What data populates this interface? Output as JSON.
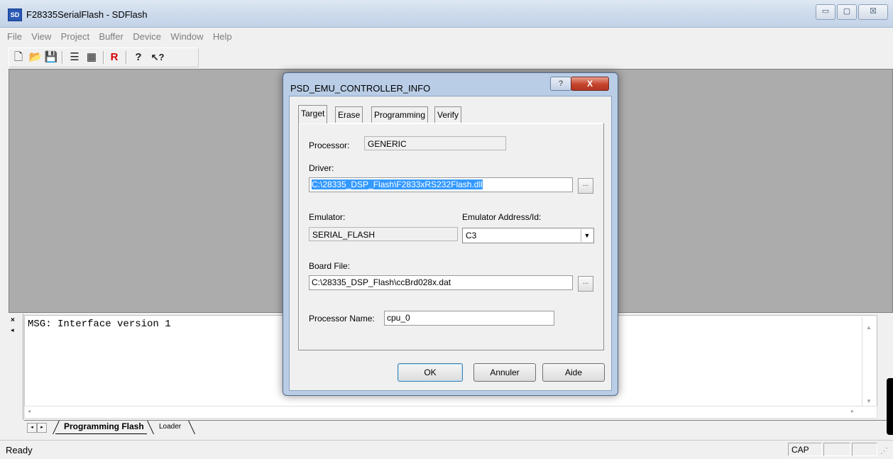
{
  "window": {
    "icon_text": "SD",
    "title": "F28335SerialFlash - SDFlash",
    "min_glyph": "▭",
    "max_glyph": "▢",
    "close_glyph": "☒"
  },
  "menu": [
    "File",
    "View",
    "Project",
    "Buffer",
    "Device",
    "Window",
    "Help"
  ],
  "toolbar": {
    "new_glyph": "🗋",
    "open_glyph": "📂",
    "save_glyph": "💾",
    "list_glyph": "☰",
    "build_glyph": "▦",
    "reset_glyph": "R",
    "about_glyph": "?",
    "context_help_glyph": "↖?"
  },
  "output": {
    "close_glyph": "×",
    "scroll_left_glyph": "◂",
    "message": "MSG: Interface version 1",
    "up_glyph": "▲",
    "down_glyph": "▼",
    "left_glyph": "◂",
    "right_glyph": "▸",
    "tabs": [
      "Programming Flash",
      "Loader"
    ]
  },
  "status": {
    "text": "Ready",
    "cap": "CAP",
    "grip": "⋰"
  },
  "dialog": {
    "title": "PSD_EMU_CONTROLLER_INFO",
    "help_glyph": "?",
    "close_glyph": "X",
    "tabs": [
      "Target",
      "Erase",
      "Programming",
      "Verify"
    ],
    "processor_label": "Processor:",
    "processor_value": "GENERIC",
    "driver_label": "Driver:",
    "driver_value": "C:\\28335_DSP_Flash\\F2833xRS232Flash.dll",
    "browse_glyph": "...",
    "emulator_label": "Emulator:",
    "emulator_value": "SERIAL_FLASH",
    "emulator_address_label": "Emulator Address/Id:",
    "emulator_address_value": "C3",
    "combo_arrow": "▼",
    "board_file_label": "Board File:",
    "board_file_value": "C:\\28335_DSP_Flash\\ccBrd028x.dat",
    "processor_name_label": "Processor Name:",
    "processor_name_value": "cpu_0",
    "ok": "OK",
    "cancel": "Annuler",
    "help": "Aide"
  }
}
